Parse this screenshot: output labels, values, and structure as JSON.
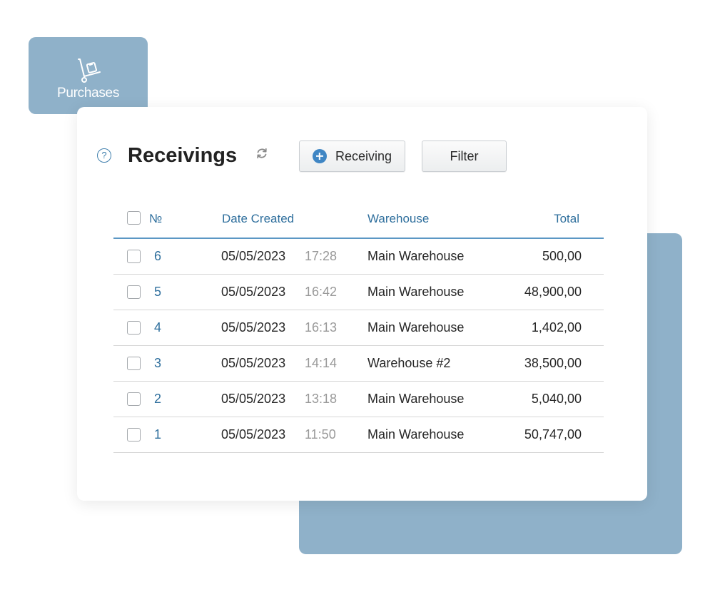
{
  "app": {
    "section_tab": "Purchases"
  },
  "header": {
    "title": "Receivings",
    "buttons": {
      "receiving_label": "Receiving",
      "filter_label": "Filter"
    }
  },
  "table": {
    "columns": {
      "number": "№",
      "date_created": "Date Created",
      "warehouse": "Warehouse",
      "total": "Total"
    },
    "rows": [
      {
        "number": "6",
        "date": "05/05/2023",
        "time": "17:28",
        "warehouse": "Main Warehouse",
        "total": "500,00"
      },
      {
        "number": "5",
        "date": "05/05/2023",
        "time": "16:42",
        "warehouse": "Main Warehouse",
        "total": "48,900,00"
      },
      {
        "number": "4",
        "date": "05/05/2023",
        "time": "16:13",
        "warehouse": "Main Warehouse",
        "total": "1,402,00"
      },
      {
        "number": "3",
        "date": "05/05/2023",
        "time": "14:14",
        "warehouse": "Warehouse #2",
        "total": "38,500,00"
      },
      {
        "number": "2",
        "date": "05/05/2023",
        "time": "13:18",
        "warehouse": "Main Warehouse",
        "total": "5,040,00"
      },
      {
        "number": "1",
        "date": "05/05/2023",
        "time": "11:50",
        "warehouse": "Main Warehouse",
        "total": "50,747,00"
      }
    ]
  },
  "icons": {
    "section_tab": "hand-truck-icon",
    "help": "help-icon",
    "refresh": "refresh-icon",
    "add": "plus-circle-icon"
  },
  "colors": {
    "accent_blue": "#2f6f9d",
    "tab_background": "#8fb1c9",
    "add_icon": "#3f86c4"
  }
}
